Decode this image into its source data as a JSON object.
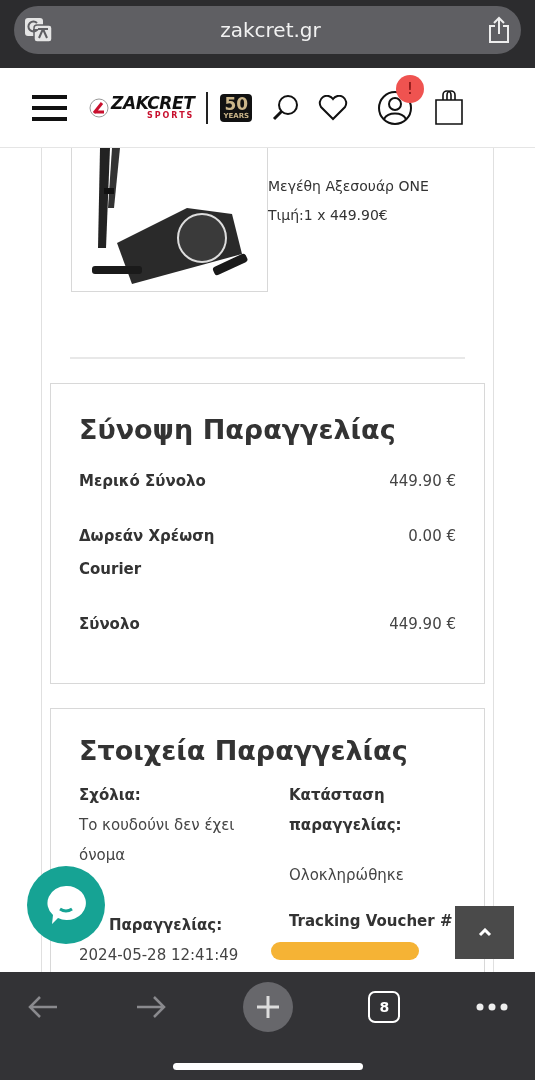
{
  "browser": {
    "url": "zakcret.gr",
    "tab_count": "8"
  },
  "header": {
    "logo_name": "ZAKCRET",
    "logo_tagline": "SPORTS",
    "anniversary_number": "50",
    "anniversary_label": "YEARS",
    "account_badge": "!"
  },
  "product": {
    "lines": [
      "Μεγέθη Αξεσουάρ ONE",
      "Τιμή:1 x 449.90€"
    ]
  },
  "summary": {
    "title": "Σύνοψη Παραγγελίας",
    "rows": [
      {
        "label": "Μερικό Σύνολο",
        "value": "449.90 €"
      },
      {
        "label": "Δωρεάν Χρέωση Courier",
        "value": "0.00 €"
      },
      {
        "label": "Σύνολο",
        "value": "449.90 €"
      }
    ]
  },
  "details": {
    "title": "Στοιχεία Παραγγελίας",
    "left": [
      {
        "label": "Σχόλια:",
        "value": "Το κουδούνι δεν έχει όνομα"
      },
      {
        "label": "Παραγγελίας:",
        "value": "2024-05-28 12:41:49"
      }
    ],
    "right": [
      {
        "label": "Κατάσταση παραγγελίας:",
        "value": "Ολοκληρώθηκε"
      },
      {
        "label": "Tracking Voucher #",
        "redacted": true
      }
    ]
  }
}
